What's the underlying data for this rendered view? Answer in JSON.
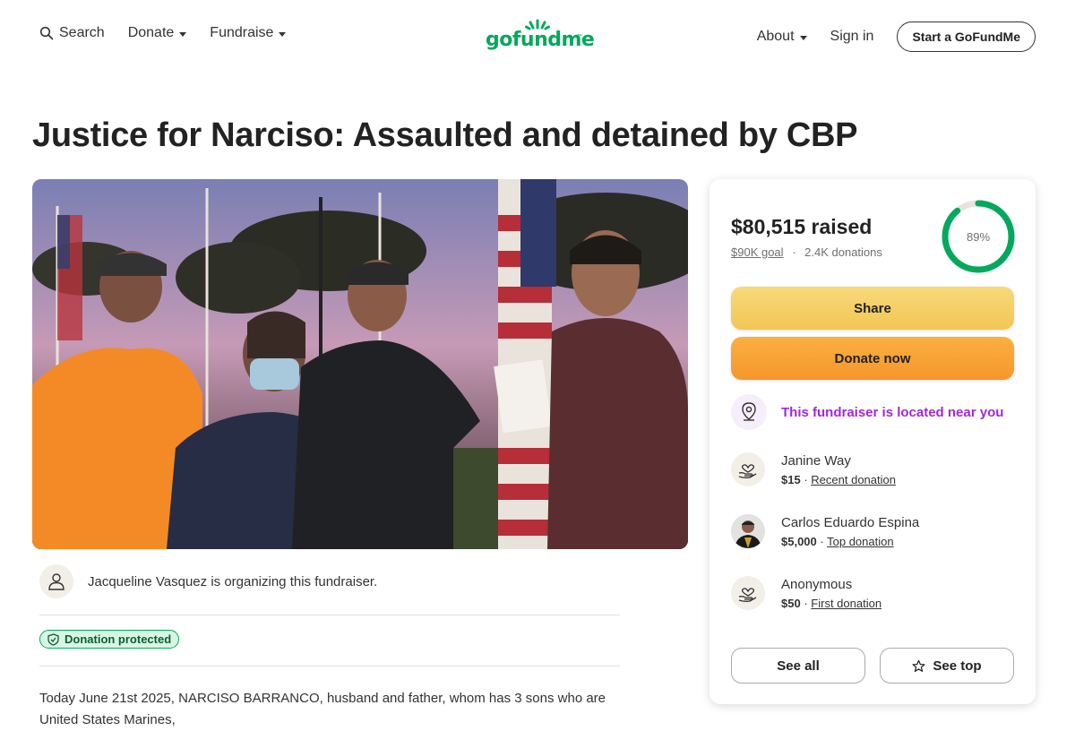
{
  "header": {
    "search_label": "Search",
    "donate_label": "Donate",
    "fundraise_label": "Fundraise",
    "logo_text": "gofundme",
    "logo_tm": "™",
    "about_label": "About",
    "signin_label": "Sign in",
    "start_label": "Start a GoFundMe"
  },
  "page": {
    "title": "Justice for Narciso: Assaulted and detained by CBP"
  },
  "organizer": {
    "text": "Jacqueline Vasquez is organizing this fundraiser."
  },
  "protection": {
    "label": "Donation protected"
  },
  "story": {
    "text": "Today June 21st 2025, NARCISO BARRANCO, husband and father, whom has 3 sons who are United States Marines,"
  },
  "donation": {
    "raised": "$80,515 raised",
    "goal": "$90K goal",
    "separator": "·",
    "count": "2.4K donations",
    "progress_label": "89%",
    "progress_fraction": 0.89,
    "share_label": "Share",
    "donate_label": "Donate now",
    "nearby_label": "This fundraiser is located near you",
    "donors": [
      {
        "name": "Janine Way",
        "amount": "$15",
        "tag": "Recent donation"
      },
      {
        "name": "Carlos Eduardo Espina",
        "amount": "$5,000",
        "tag": "Top donation"
      },
      {
        "name": "Anonymous",
        "amount": "$50",
        "tag": "First donation"
      }
    ],
    "see_all_label": "See all",
    "see_top_label": "See top"
  },
  "colors": {
    "brand_green": "#02a95c",
    "share_yellow": "#f2c654",
    "donate_orange": "#f6962c",
    "nearby_purple": "#a427d8"
  },
  "icons": {
    "search": "search-icon",
    "logo": "sun-logo-icon",
    "organizer": "person-icon",
    "shield": "shield-icon",
    "location": "location-pin-icon",
    "donation": "heart-hand-icon",
    "star": "star-icon"
  }
}
